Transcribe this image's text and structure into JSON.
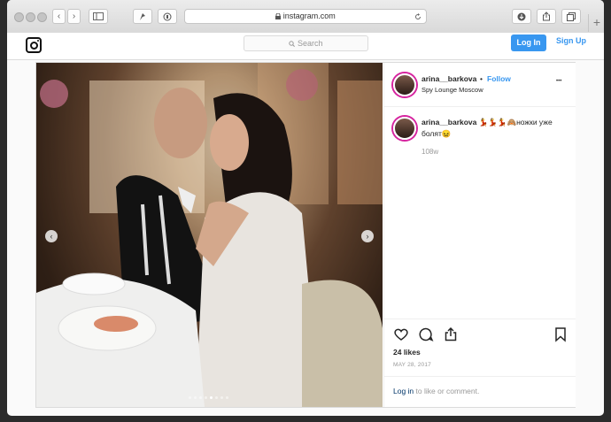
{
  "browser": {
    "url": "instagram.com",
    "nav_back": "‹",
    "nav_forward": "›"
  },
  "header": {
    "search_placeholder": "Search",
    "login_label": "Log In",
    "signup_label": "Sign Up"
  },
  "post": {
    "username": "arina__barkova",
    "separator": "•",
    "follow_label": "Follow",
    "location": "Spy Lounge Moscow",
    "more_label": "•••",
    "caption_user": "arina__barkova",
    "caption_text": "💃💃💃🙈ножки уже болят😖",
    "comment_time": "108w",
    "likes": "24 likes",
    "date": "MAY 28, 2017",
    "login_link": "Log in",
    "login_prompt": " to like or comment."
  },
  "carousel": {
    "prev": "‹",
    "next": "›",
    "dots": 8,
    "active_dot": 4
  },
  "colors": {
    "accent": "#3897f0",
    "ring": "#d6249f"
  }
}
